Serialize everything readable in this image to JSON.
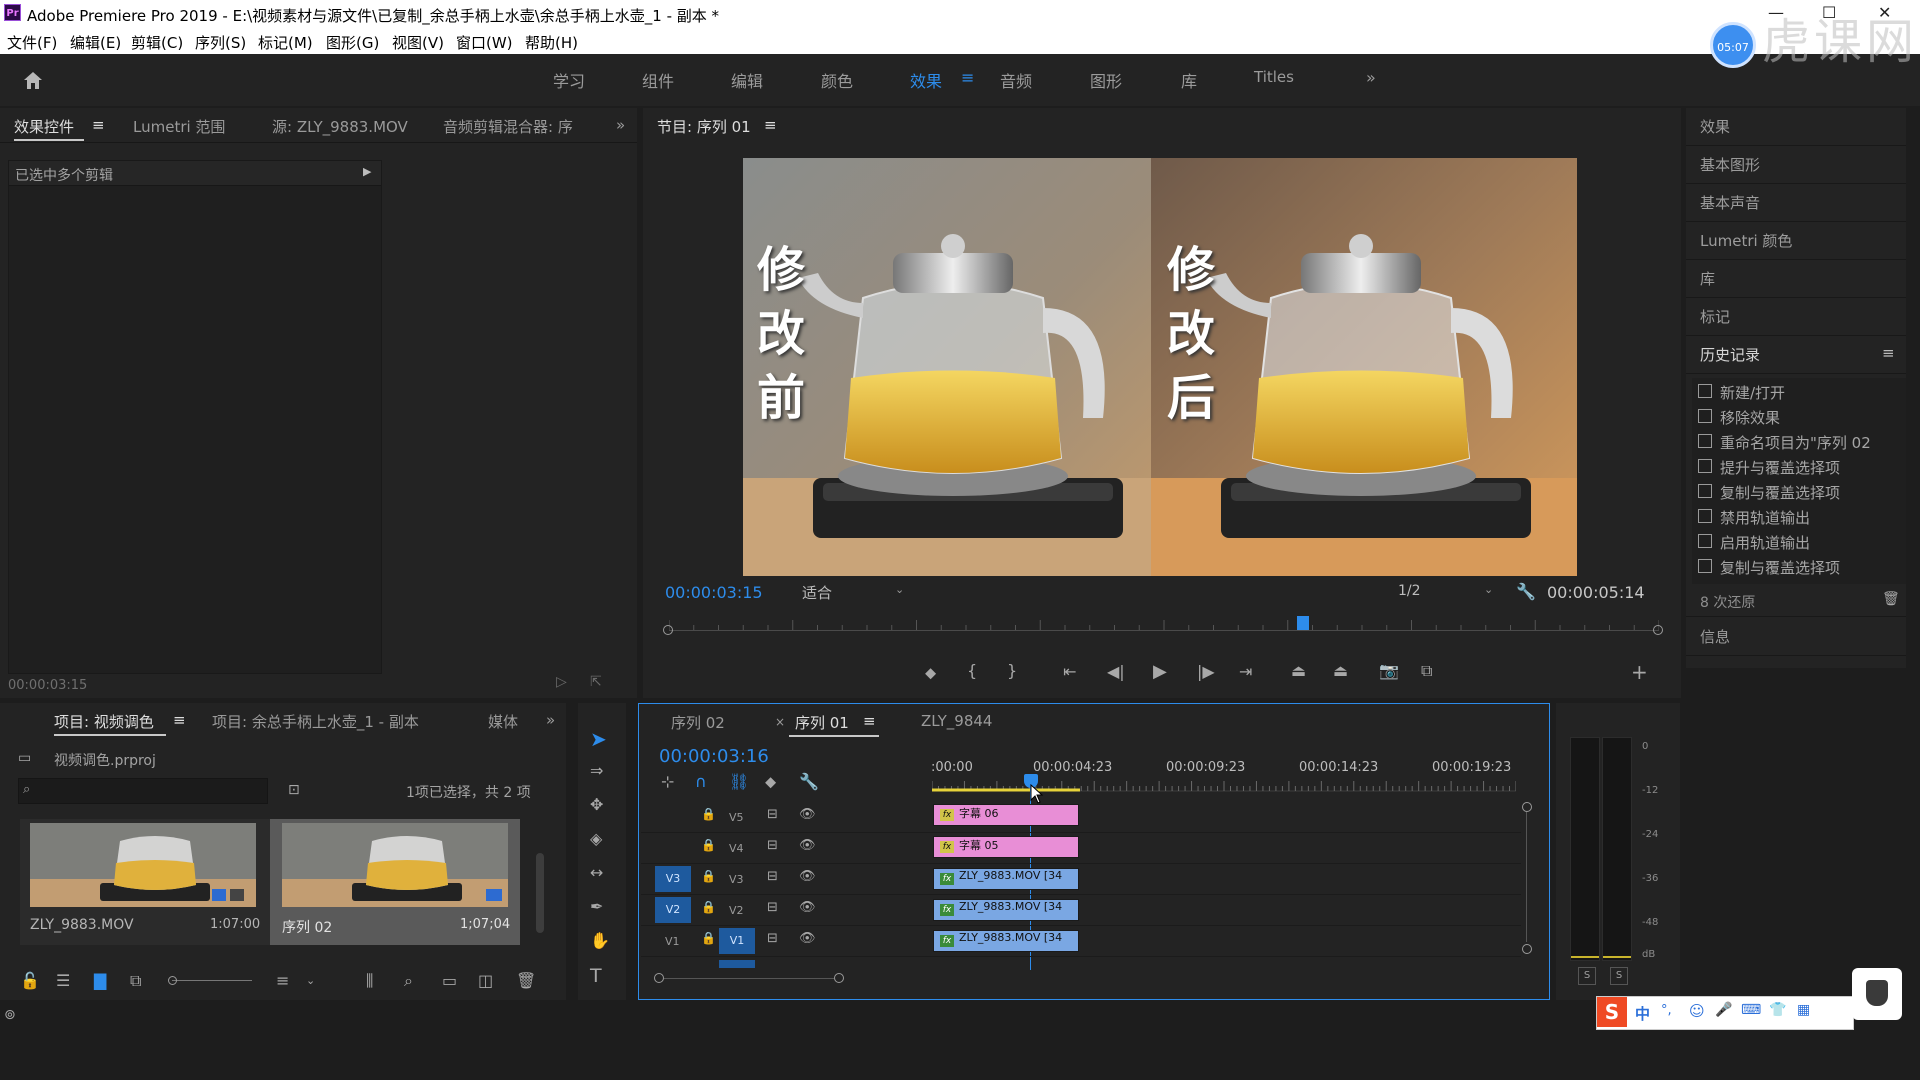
{
  "app": {
    "title": "Adobe Premiere Pro 2019 - E:\\视频素材与源文件\\已复制_余总手柄上水壶\\余总手柄上水壶_1 - 副本 *",
    "logo_text": "Pr",
    "watermark": "虎课网",
    "watermark_badge": "05:07"
  },
  "menu": [
    "文件(F)",
    "编辑(E)",
    "剪辑(C)",
    "序列(S)",
    "标记(M)",
    "图形(G)",
    "视图(V)",
    "窗口(W)",
    "帮助(H)"
  ],
  "workspaces": [
    "学习",
    "组件",
    "编辑",
    "颜色",
    "效果",
    "音频",
    "图形",
    "库",
    "Titles"
  ],
  "source_panel": {
    "tabs": [
      "效果控件",
      "Lumetri 范围",
      "源: ZLY_9883.MOV",
      "音频剪辑混合器: 序"
    ],
    "selected_text": "已选中多个剪辑",
    "timecode": "00:00:03:15"
  },
  "program": {
    "title": "节目: 序列 01",
    "timecode": "00:00:03:15",
    "fit_label": "适合",
    "resolution": "1/2",
    "duration": "00:00:05:14",
    "left_caption": [
      "修",
      "改",
      "前"
    ],
    "right_caption": [
      "修",
      "改",
      "后"
    ],
    "playhead_fraction": 0.64
  },
  "right_panel": {
    "items": [
      "效果",
      "基本图形",
      "基本声音",
      "Lumetri 颜色",
      "库",
      "标记"
    ],
    "history_title": "历史记录",
    "history": [
      "新建/打开",
      "移除效果",
      "重命名项目为\"序列 02",
      "提升与覆盖选择项",
      "复制与覆盖选择项",
      "禁用轨道输出",
      "启用轨道输出",
      "复制与覆盖选择项"
    ],
    "undo_count": "8 次还原",
    "info": "信息"
  },
  "project": {
    "tabs": [
      "项目: 视频调色",
      "项目: 余总手柄上水壶_1 - 副本",
      "媒体"
    ],
    "file": "视频调色.prproj",
    "selection": "1项已选择，共 2 项",
    "items": [
      {
        "name": "ZLY_9883.MOV",
        "duration": "1:07:00"
      },
      {
        "name": "序列 02",
        "duration": "1;07;04"
      }
    ]
  },
  "timeline": {
    "tabs": [
      "序列 02",
      "序列 01",
      "ZLY_9844"
    ],
    "timecode": "00:00:03:16",
    "ruler": [
      ":00:00",
      "00:00:04:23",
      "00:00:09:23",
      "00:00:14:23",
      "00:00:19:23"
    ],
    "tracks": [
      {
        "name": "V5",
        "clip": "字幕 06"
      },
      {
        "name": "V4",
        "clip": "字幕 05"
      },
      {
        "name": "V3",
        "clip": "ZLY_9883.MOV [34"
      },
      {
        "name": "V2",
        "clip": "ZLY_9883.MOV [34"
      },
      {
        "name": "V1",
        "clip": "ZLY_9883.MOV [34"
      }
    ],
    "fx_label": "fx"
  },
  "vu": {
    "labels": [
      "0",
      "-12",
      "-24",
      "-36",
      "-48",
      "dB"
    ],
    "solo": [
      "S",
      "S"
    ]
  },
  "ime": [
    "中",
    "°,",
    "☺",
    "🎤",
    "⌨",
    "👕",
    "▦"
  ],
  "colors": {
    "accent": "#2d8ceb",
    "pink_clip": "#e88ed6",
    "blue_clip": "#7aa7e3"
  }
}
